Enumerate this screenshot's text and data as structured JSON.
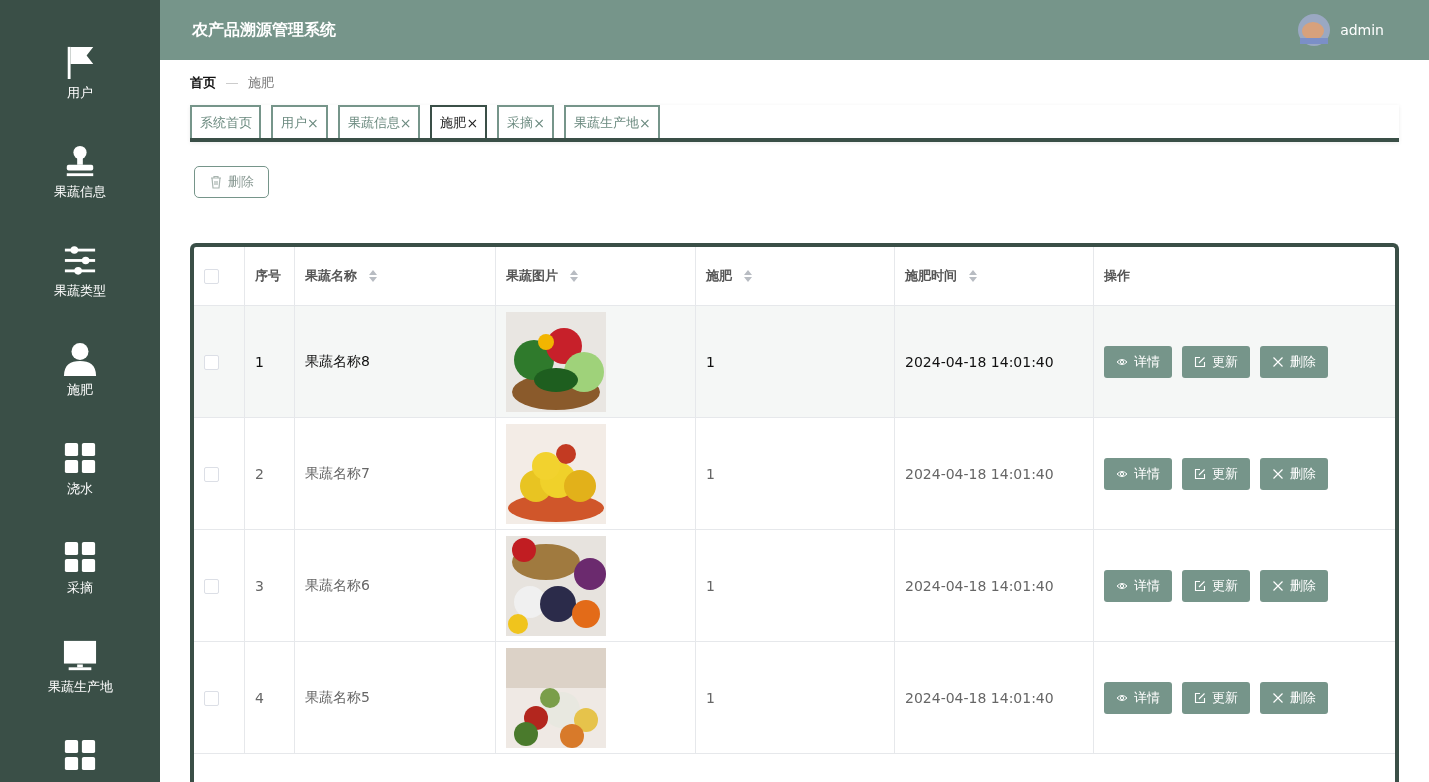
{
  "sidebar": {
    "items": [
      {
        "label": "用户",
        "kind": "flag"
      },
      {
        "label": "果蔬信息",
        "kind": "stamp"
      },
      {
        "label": "果蔬类型",
        "kind": "sliders"
      },
      {
        "label": "施肥",
        "kind": "person"
      },
      {
        "label": "浇水",
        "kind": "grid"
      },
      {
        "label": "采摘",
        "kind": "grid"
      },
      {
        "label": "果蔬生产地",
        "kind": "monitor"
      },
      {
        "kind": "grid"
      }
    ]
  },
  "header": {
    "title": "农产品溯源管理系统",
    "user": "admin"
  },
  "breadcrumb": [
    "首页",
    "施肥"
  ],
  "tabs": [
    {
      "label": "系统首页",
      "closable": false,
      "selected": false
    },
    {
      "label": "用户",
      "closable": true,
      "selected": false
    },
    {
      "label": "果蔬信息",
      "closable": true,
      "selected": false
    },
    {
      "label": "施肥",
      "closable": true,
      "selected": true
    },
    {
      "label": "采摘",
      "closable": true,
      "selected": false
    },
    {
      "label": "果蔬生产地",
      "closable": true,
      "selected": false
    }
  ],
  "tab_close": "×",
  "toolbar": {
    "delete_button": "删除"
  },
  "table": {
    "select_all": {
      "checked": false
    },
    "columns": [
      {
        "label": "序号",
        "sortable": false
      },
      {
        "label": "果蔬名称",
        "sortable": true
      },
      {
        "label": "果蔬图片",
        "sortable": true
      },
      {
        "label": "施肥",
        "sortable": true
      },
      {
        "label": "施肥时间",
        "sortable": true
      },
      {
        "label": "操作",
        "sortable": false
      }
    ],
    "rows": [
      {
        "index": "1",
        "name": "果蔬名称8",
        "image": {
          "kind": "picture"
        },
        "fertilizer": "1",
        "time": "2024-04-18 14:01:40",
        "checked": false,
        "highlighted": true,
        "actions": [
          "详情",
          "更新",
          "删除"
        ]
      },
      {
        "index": "2",
        "name": "果蔬名称7",
        "image": {
          "kind": "picture"
        },
        "fertilizer": "1",
        "time": "2024-04-18 14:01:40",
        "checked": false,
        "highlighted": false,
        "actions": [
          "详情",
          "更新",
          "删除"
        ]
      },
      {
        "index": "3",
        "name": "果蔬名称6",
        "image": {
          "kind": "picture"
        },
        "fertilizer": "1",
        "time": "2024-04-18 14:01:40",
        "checked": false,
        "highlighted": false,
        "actions": [
          "详情",
          "更新",
          "删除"
        ]
      },
      {
        "index": "4",
        "name": "果蔬名称5",
        "image": {
          "kind": "picture"
        },
        "fertilizer": "1",
        "time": "2024-04-18 14:01:40",
        "checked": false,
        "highlighted": false,
        "actions": [
          "详情",
          "更新",
          "删除"
        ]
      }
    ]
  }
}
